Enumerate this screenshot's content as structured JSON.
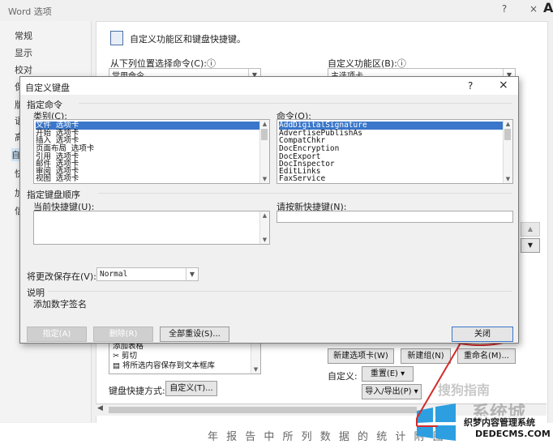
{
  "window": {
    "title": "Word 选项",
    "help": "?",
    "close": "×",
    "corner_char": "A"
  },
  "nav": {
    "items": [
      "常规",
      "显示",
      "校对",
      "保",
      "版",
      "语",
      "高",
      "自",
      "快",
      "加",
      "信"
    ]
  },
  "main": {
    "header": "自定义功能区和键盘快捷键。",
    "from_label": "从下列位置选择命令(C):ⓘ",
    "from_value": "常用命令",
    "ribbon_label": "自定义功能区(B):ⓘ",
    "ribbon_value": "主选项卡",
    "left_list": [
      "添加表格",
      "剪切",
      "将所选内容保存到文本框库"
    ],
    "new_tab": "新建选项卡(W)",
    "new_group": "新建组(N)",
    "rename": "重命名(M)...",
    "customize_label": "自定义:",
    "reset": "重置(E) ▾",
    "import_export": "导入/导出(P) ▾",
    "kb_label": "键盘快捷方式:",
    "kb_button": "自定义(T)...",
    "watermark1": "搜狗指南",
    "watermark2": "系统城",
    "watermark3": "织梦内容管理系统",
    "watermark4": "DEDECMS.COM",
    "background_text": "年 报 告 中 所 列 数 据 的 统 计 附 图 自 ……"
  },
  "dialog": {
    "title": "自定义键盘",
    "help": "?",
    "close": "×",
    "section_commands": "指定命令",
    "categories_label": "类别(C):",
    "categories": [
      "文件 选项卡",
      "开始 选项卡",
      "插入 选项卡",
      "页面布局 选项卡",
      "引用 选项卡",
      "邮件 选项卡",
      "审阅 选项卡",
      "视图 选项卡"
    ],
    "commands_label": "命令(O):",
    "commands": [
      "AddDigitalSignature",
      "AdvertisePublishAs",
      "CompatChkr",
      "DocEncryption",
      "DocExport",
      "DocInspector",
      "EditLinks",
      "FaxService"
    ],
    "section_keys": "指定键盘顺序",
    "current_keys_label": "当前快捷键(U):",
    "new_key_label": "请按新快捷键(N):",
    "save_in_label": "将更改保存在(V):",
    "save_in_value": "Normal",
    "desc_label": "说明",
    "desc_text": "添加数字签名",
    "assign_btn": "指定(A)",
    "remove_btn": "删除(R)",
    "reset_all_btn": "全部重设(S)...",
    "close_btn": "关闭"
  }
}
